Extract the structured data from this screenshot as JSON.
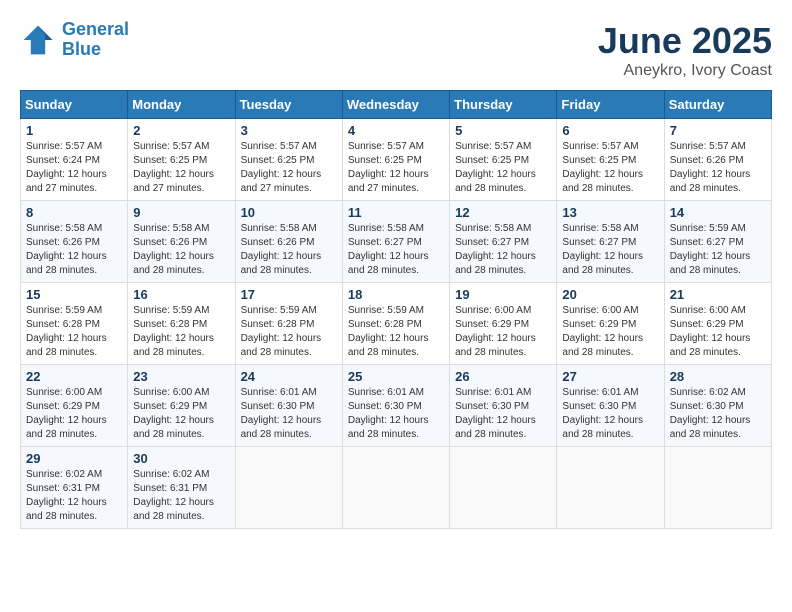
{
  "header": {
    "logo_line1": "General",
    "logo_line2": "Blue",
    "month": "June 2025",
    "location": "Aneykro, Ivory Coast"
  },
  "weekdays": [
    "Sunday",
    "Monday",
    "Tuesday",
    "Wednesday",
    "Thursday",
    "Friday",
    "Saturday"
  ],
  "weeks": [
    [
      {
        "day": "1",
        "sunrise": "5:57 AM",
        "sunset": "6:24 PM",
        "daylight": "12 hours and 27 minutes."
      },
      {
        "day": "2",
        "sunrise": "5:57 AM",
        "sunset": "6:25 PM",
        "daylight": "12 hours and 27 minutes."
      },
      {
        "day": "3",
        "sunrise": "5:57 AM",
        "sunset": "6:25 PM",
        "daylight": "12 hours and 27 minutes."
      },
      {
        "day": "4",
        "sunrise": "5:57 AM",
        "sunset": "6:25 PM",
        "daylight": "12 hours and 27 minutes."
      },
      {
        "day": "5",
        "sunrise": "5:57 AM",
        "sunset": "6:25 PM",
        "daylight": "12 hours and 28 minutes."
      },
      {
        "day": "6",
        "sunrise": "5:57 AM",
        "sunset": "6:25 PM",
        "daylight": "12 hours and 28 minutes."
      },
      {
        "day": "7",
        "sunrise": "5:57 AM",
        "sunset": "6:26 PM",
        "daylight": "12 hours and 28 minutes."
      }
    ],
    [
      {
        "day": "8",
        "sunrise": "5:58 AM",
        "sunset": "6:26 PM",
        "daylight": "12 hours and 28 minutes."
      },
      {
        "day": "9",
        "sunrise": "5:58 AM",
        "sunset": "6:26 PM",
        "daylight": "12 hours and 28 minutes."
      },
      {
        "day": "10",
        "sunrise": "5:58 AM",
        "sunset": "6:26 PM",
        "daylight": "12 hours and 28 minutes."
      },
      {
        "day": "11",
        "sunrise": "5:58 AM",
        "sunset": "6:27 PM",
        "daylight": "12 hours and 28 minutes."
      },
      {
        "day": "12",
        "sunrise": "5:58 AM",
        "sunset": "6:27 PM",
        "daylight": "12 hours and 28 minutes."
      },
      {
        "day": "13",
        "sunrise": "5:58 AM",
        "sunset": "6:27 PM",
        "daylight": "12 hours and 28 minutes."
      },
      {
        "day": "14",
        "sunrise": "5:59 AM",
        "sunset": "6:27 PM",
        "daylight": "12 hours and 28 minutes."
      }
    ],
    [
      {
        "day": "15",
        "sunrise": "5:59 AM",
        "sunset": "6:28 PM",
        "daylight": "12 hours and 28 minutes."
      },
      {
        "day": "16",
        "sunrise": "5:59 AM",
        "sunset": "6:28 PM",
        "daylight": "12 hours and 28 minutes."
      },
      {
        "day": "17",
        "sunrise": "5:59 AM",
        "sunset": "6:28 PM",
        "daylight": "12 hours and 28 minutes."
      },
      {
        "day": "18",
        "sunrise": "5:59 AM",
        "sunset": "6:28 PM",
        "daylight": "12 hours and 28 minutes."
      },
      {
        "day": "19",
        "sunrise": "6:00 AM",
        "sunset": "6:29 PM",
        "daylight": "12 hours and 28 minutes."
      },
      {
        "day": "20",
        "sunrise": "6:00 AM",
        "sunset": "6:29 PM",
        "daylight": "12 hours and 28 minutes."
      },
      {
        "day": "21",
        "sunrise": "6:00 AM",
        "sunset": "6:29 PM",
        "daylight": "12 hours and 28 minutes."
      }
    ],
    [
      {
        "day": "22",
        "sunrise": "6:00 AM",
        "sunset": "6:29 PM",
        "daylight": "12 hours and 28 minutes."
      },
      {
        "day": "23",
        "sunrise": "6:00 AM",
        "sunset": "6:29 PM",
        "daylight": "12 hours and 28 minutes."
      },
      {
        "day": "24",
        "sunrise": "6:01 AM",
        "sunset": "6:30 PM",
        "daylight": "12 hours and 28 minutes."
      },
      {
        "day": "25",
        "sunrise": "6:01 AM",
        "sunset": "6:30 PM",
        "daylight": "12 hours and 28 minutes."
      },
      {
        "day": "26",
        "sunrise": "6:01 AM",
        "sunset": "6:30 PM",
        "daylight": "12 hours and 28 minutes."
      },
      {
        "day": "27",
        "sunrise": "6:01 AM",
        "sunset": "6:30 PM",
        "daylight": "12 hours and 28 minutes."
      },
      {
        "day": "28",
        "sunrise": "6:02 AM",
        "sunset": "6:30 PM",
        "daylight": "12 hours and 28 minutes."
      }
    ],
    [
      {
        "day": "29",
        "sunrise": "6:02 AM",
        "sunset": "6:31 PM",
        "daylight": "12 hours and 28 minutes."
      },
      {
        "day": "30",
        "sunrise": "6:02 AM",
        "sunset": "6:31 PM",
        "daylight": "12 hours and 28 minutes."
      },
      null,
      null,
      null,
      null,
      null
    ]
  ],
  "labels": {
    "sunrise": "Sunrise:",
    "sunset": "Sunset:",
    "daylight": "Daylight:"
  }
}
